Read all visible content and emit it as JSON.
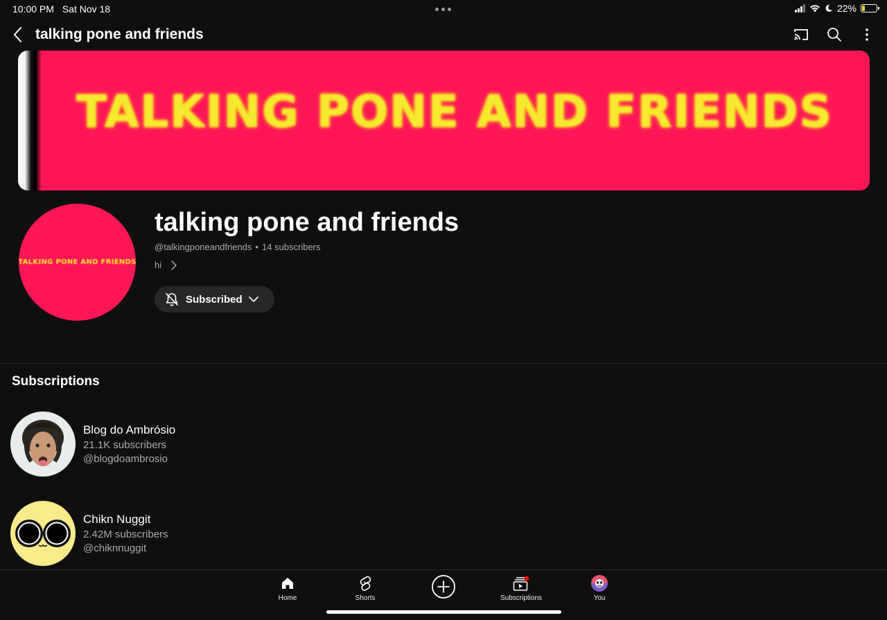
{
  "status_bar": {
    "time": "10:00 PM",
    "date": "Sat Nov 18",
    "battery_percent": "22%",
    "battery_level": 0.22
  },
  "app_bar": {
    "title": "talking pone and friends",
    "icons": [
      "back-chevron-icon",
      "cast-icon",
      "search-icon",
      "more-vert-icon"
    ]
  },
  "banner": {
    "text": "TALKING PONE AND FRIENDS"
  },
  "channel": {
    "avatar_text": "TALKING PONE AND FRIENDS",
    "name": "talking pone and friends",
    "handle": "@talkingponeandfriends",
    "separator": "•",
    "subscribers": "14 subscribers",
    "description": "hi",
    "subscribe_label": "Subscribed"
  },
  "subscriptions": {
    "title": "Subscriptions",
    "items": [
      {
        "name": "Blog do Ambrósio",
        "subscribers": "21.1K subscribers",
        "handle": "@blogdoambrosio"
      },
      {
        "name": "Chikn Nuggit",
        "subscribers": "2.42M subscribers",
        "handle": "@chiknnuggit"
      }
    ]
  },
  "bottom_nav": {
    "items": [
      {
        "label": "Home",
        "icon": "home-icon"
      },
      {
        "label": "Shorts",
        "icon": "shorts-icon"
      },
      {
        "label": "",
        "icon": "create-plus-icon"
      },
      {
        "label": "Subscriptions",
        "icon": "subscriptions-icon"
      },
      {
        "label": "You",
        "icon": "you-avatar"
      }
    ]
  },
  "colors": {
    "background": "#0f0f0f",
    "banner": "#ff1656",
    "banner_text": "#f5ea2d",
    "notification_dot": "#ff0000"
  }
}
